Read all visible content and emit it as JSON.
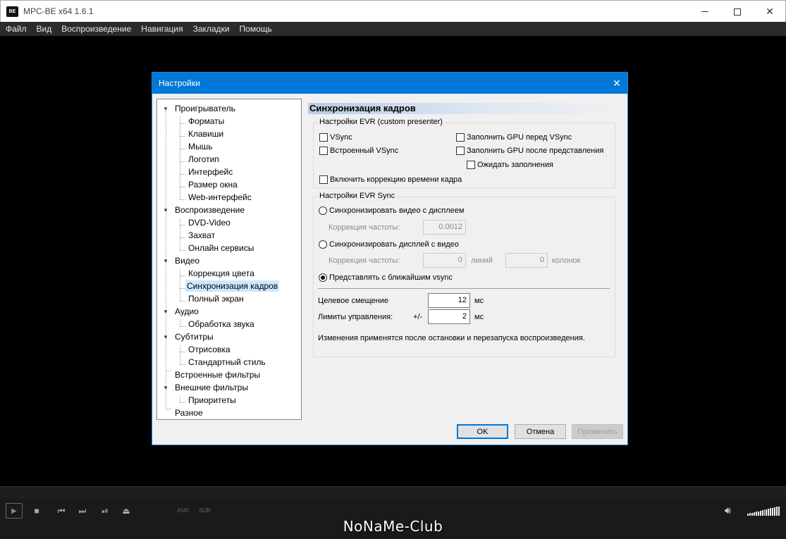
{
  "window": {
    "title": "MPC-BE x64 1.6.1",
    "icon_text": "BE"
  },
  "menu": [
    "Файл",
    "Вид",
    "Воспроизведение",
    "Навигация",
    "Закладки",
    "Помощь"
  ],
  "dialog": {
    "title": "Настройки",
    "tree": [
      "Проигрыватель",
      "Форматы",
      "Клавиши",
      "Мышь",
      "Логотип",
      "Интерфейс",
      "Размер окна",
      "Web-интерфейс",
      "Воспроизведение",
      "DVD-Video",
      "Захват",
      "Онлайн сервисы",
      "Видео",
      "Коррекция цвета",
      "Синхронизация кадров",
      "Полный экран",
      "Аудио",
      "Обработка звука",
      "Субтитры",
      "Отрисовка",
      "Стандартный стиль",
      "Встроенные фильтры",
      "Внешние фильтры",
      "Приоритеты",
      "Разное"
    ],
    "selected_item": "Синхронизация кадров",
    "page_title": "Синхронизация кадров",
    "evr": {
      "group_label": "Настройки EVR (custom presenter)",
      "vsync": "VSync",
      "builtin_vsync": "Встроенный VSync",
      "flush_gpu_before": "Заполнить GPU перед VSync",
      "flush_gpu_after": "Заполнить GPU после представления",
      "wait_flush": "Ожидать заполнения",
      "frame_time_correction": "Включить коррекцию времени кадра"
    },
    "sync": {
      "group_label": "Настройки EVR Sync",
      "sync_video_to_display": "Синхронизировать видео с дисплеем",
      "freq_correction_label": "Коррекция частоты:",
      "freq_correction_value": "0.0012",
      "sync_display_to_video": "Синхронизировать дисплей с видео",
      "freq_correction_label2": "Коррекция частоты:",
      "lines_value": "0",
      "lines_label": "линий",
      "columns_value": "0",
      "columns_label": "колонок",
      "present_nearest_vsync": "Представлять с ближайшим vsync",
      "target_offset_label": "Целевое смещение",
      "target_offset_value": "12",
      "target_offset_unit": "мс",
      "control_limits_label": "Лимиты управления:",
      "control_limits_prefix": "+/-",
      "control_limits_value": "2",
      "control_limits_unit": "мс",
      "note": "Изменения применятся после остановки и перезапуска воспроизведения."
    },
    "buttons": {
      "ok": "OK",
      "cancel": "Отмена",
      "apply": "Применить"
    }
  },
  "player": {
    "aud_label": "AUD",
    "sub_label": "SUB",
    "volume_level": 1.0
  },
  "watermark": "NoNaMe-Club"
}
